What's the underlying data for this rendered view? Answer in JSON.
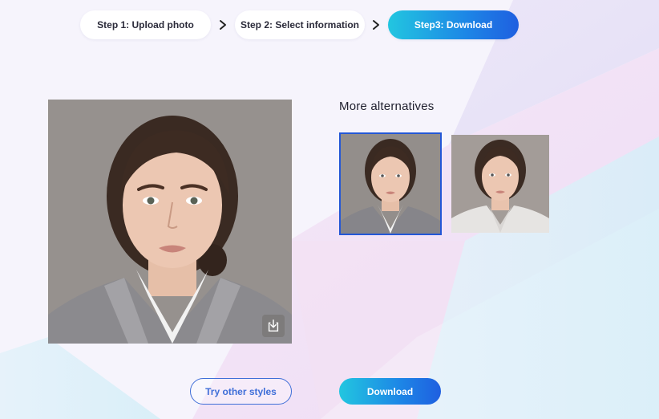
{
  "steps": [
    {
      "label": "Step 1: Upload photo",
      "active": false
    },
    {
      "label": "Step 2: Select information",
      "active": false
    },
    {
      "label": "Step3: Download",
      "active": true
    }
  ],
  "alternatives": {
    "title": "More alternatives",
    "selected_index": 0
  },
  "actions": {
    "try_other_styles": "Try other styles",
    "download": "Download"
  },
  "colors": {
    "accent_start": "#22c6e0",
    "accent_end": "#1f5fe0",
    "selected_border": "#2457d6"
  }
}
